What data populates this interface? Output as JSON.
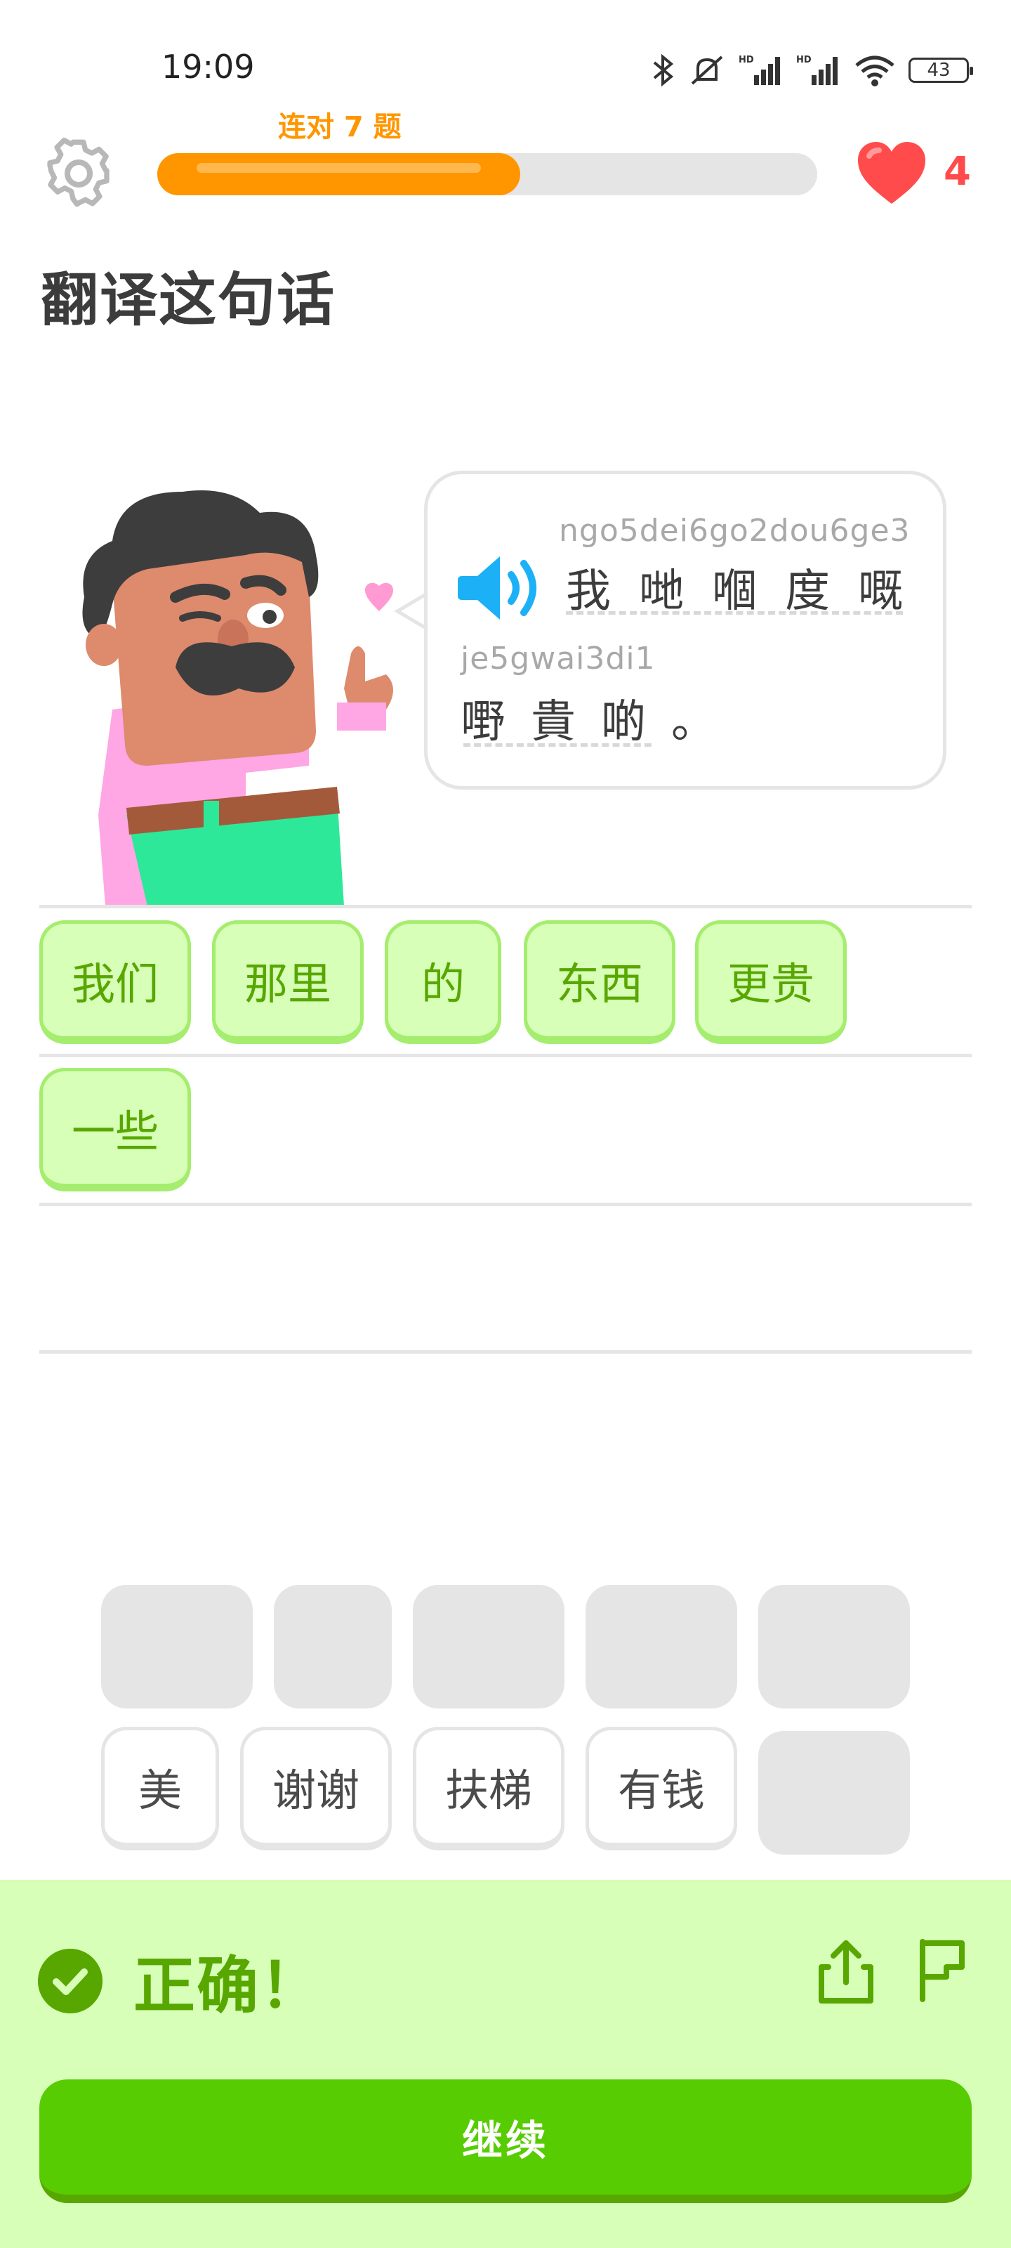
{
  "status_bar": {
    "time": "19:09",
    "battery": "43",
    "icons": [
      "bluetooth-icon",
      "mute-icon",
      "signal-icon",
      "signal-icon",
      "wifi-icon",
      "battery-icon"
    ]
  },
  "header": {
    "streak_text": "连对 7 题",
    "progress_fraction": 0.55,
    "hearts": "4",
    "colors": {
      "progress": "#ff9600",
      "heart": "#ff4b4b"
    }
  },
  "challenge": {
    "title": "翻译这句话",
    "prompt_line1_romanization": "ngo5dei6go2dou6ge3",
    "prompt_line1_text": "我哋嗰度嘅",
    "prompt_line2_romanization": "je5gwai3di1",
    "prompt_line2_text": "嘢貴啲。"
  },
  "answer": {
    "selected_tiles": [
      "我们",
      "那里",
      "的",
      "东西",
      "更贵",
      "一些"
    ]
  },
  "word_bank": {
    "row1": [
      "",
      "",
      "",
      "",
      ""
    ],
    "row2": [
      "美",
      "谢谢",
      "扶梯",
      "有钱",
      ""
    ]
  },
  "feedback": {
    "result_text": "正确！",
    "continue_label": "继续",
    "colors": {
      "panel": "#d7ffb8",
      "accent": "#58a700",
      "button": "#58cc02"
    }
  }
}
